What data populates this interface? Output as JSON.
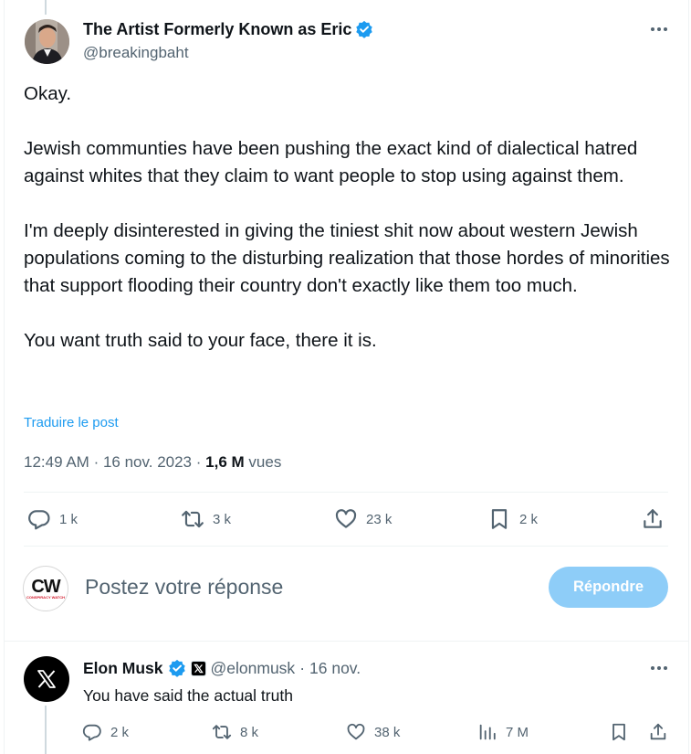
{
  "tweet": {
    "author_name": "The Artist Formerly Known as Eric",
    "author_handle": "@breakingbaht",
    "paragraphs": [
      "Okay.",
      "Jewish communties have been pushing the exact kind of dialectical hatred against whites that they claim to want people to stop using against them.",
      "I'm deeply disinterested in giving the tiniest shit now about western Jewish populations coming to the disturbing realization that those hordes of minorities that support flooding their country don't exactly like them too much.",
      "You want truth said to your face, there it is."
    ],
    "translate_link": "Traduire le post",
    "time": "12:49 AM",
    "sep": "·",
    "date": "16 nov. 2023",
    "views_count": "1,6 M",
    "views_label": "vues",
    "stats": {
      "replies": "1 k",
      "reposts": "3 k",
      "likes": "23 k",
      "bookmarks": "2 k"
    },
    "icons": [
      "reply-icon",
      "repost-icon",
      "like-icon",
      "bookmark-icon",
      "share-icon",
      "more-icon",
      "verified-badge-icon"
    ]
  },
  "composer": {
    "avatar_text": "CW",
    "avatar_subtext": "CONSPIRACY WATCH",
    "placeholder": "Postez votre réponse",
    "button_label": "Répondre"
  },
  "reply": {
    "author_name": "Elon Musk",
    "author_handle": "@elonmusk",
    "sep": "·",
    "date": "16 nov.",
    "text": "You have said the actual truth",
    "stats": {
      "replies": "2 k",
      "reposts": "8 k",
      "likes": "38 k",
      "views": "7 M"
    }
  },
  "colors": {
    "text": "#0f1419",
    "muted": "#536471",
    "link": "#1d9bf0",
    "verified": "#1d9bf0",
    "button_disabled": "#8ecdf8",
    "divider": "#eff3f4"
  }
}
